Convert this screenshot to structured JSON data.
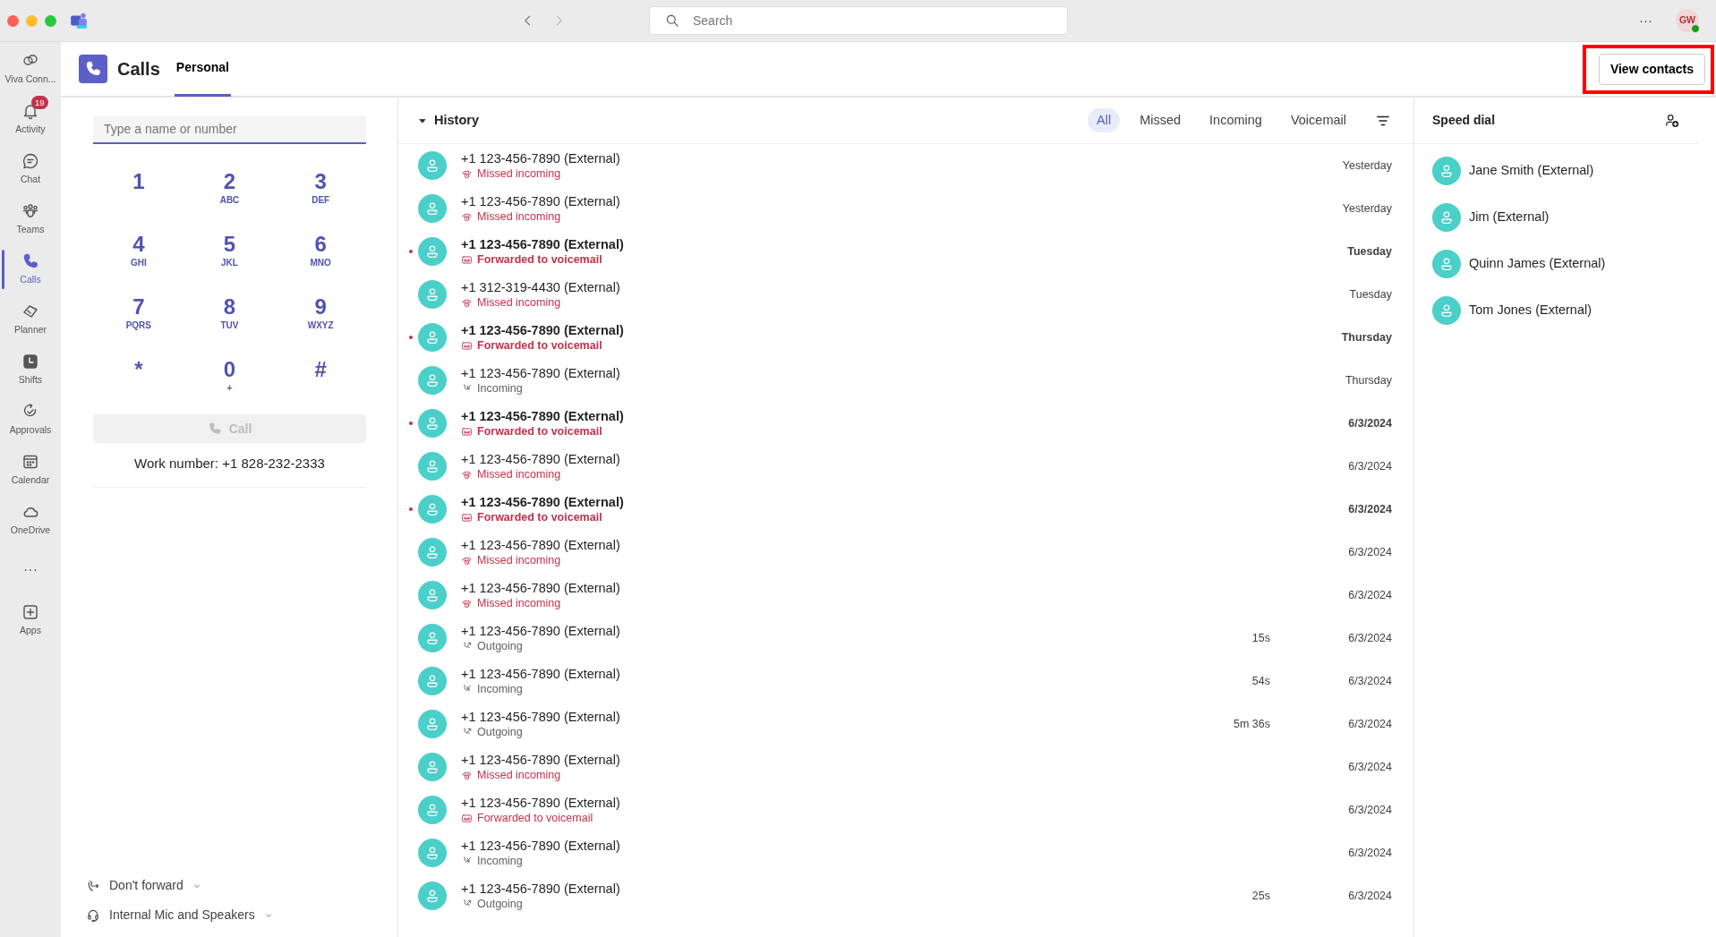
{
  "titlebar": {
    "search_placeholder": "Search",
    "more": "···",
    "avatar_initials": "GW",
    "online": true
  },
  "rail": [
    {
      "label": "Viva Conn...",
      "selected": false
    },
    {
      "label": "Activity",
      "selected": false,
      "badge": "19"
    },
    {
      "label": "Chat",
      "selected": false
    },
    {
      "label": "Teams",
      "selected": false
    },
    {
      "label": "Calls",
      "selected": true
    },
    {
      "label": "Planner",
      "selected": false
    },
    {
      "label": "Shifts",
      "selected": false
    },
    {
      "label": "Approvals",
      "selected": false
    },
    {
      "label": "Calendar",
      "selected": false
    },
    {
      "label": "OneDrive",
      "selected": false
    },
    {
      "label": "···",
      "selected": false
    },
    {
      "label": "Apps",
      "selected": false
    }
  ],
  "header": {
    "title": "Calls",
    "tabs": [
      {
        "label": "Personal",
        "selected": true
      }
    ],
    "view_contacts": {
      "label": "View contacts",
      "highlighted": true
    }
  },
  "dialpad": {
    "placeholder": "Type a name or number",
    "keys": [
      {
        "digit": "1"
      },
      {
        "digit": "2",
        "letters": "ABC"
      },
      {
        "digit": "3",
        "letters": "DEF"
      },
      {
        "digit": "4",
        "letters": "GHI"
      },
      {
        "digit": "5",
        "letters": "JKL"
      },
      {
        "digit": "6",
        "letters": "MNO"
      },
      {
        "digit": "7",
        "letters": "PQRS"
      },
      {
        "digit": "8",
        "letters": "TUV"
      },
      {
        "digit": "9",
        "letters": "WXYZ"
      },
      {
        "digit": "*"
      },
      {
        "digit": "0",
        "letters": "+"
      },
      {
        "digit": "#"
      }
    ],
    "call_button": {
      "label": "Call",
      "disabled": true
    },
    "work_number": "Work number: +1 828-232-2333",
    "settings": [
      {
        "label": "Don't forward"
      },
      {
        "label": "Internal Mic and Speakers"
      }
    ]
  },
  "history": {
    "title": "History",
    "expanded": true,
    "filters": [
      {
        "label": "All",
        "selected": true
      },
      {
        "label": "Missed",
        "selected": false
      },
      {
        "label": "Incoming",
        "selected": false
      },
      {
        "label": "Voicemail",
        "selected": false
      }
    ],
    "rows": [
      {
        "number": "+1 123-456-7890 (External)",
        "kind": "missed",
        "status": "Missed incoming",
        "unread": false,
        "date": "Yesterday"
      },
      {
        "number": "+1 123-456-7890 (External)",
        "kind": "missed",
        "status": "Missed incoming",
        "unread": false,
        "date": "Yesterday"
      },
      {
        "number": "+1 123-456-7890 (External)",
        "kind": "voicemail",
        "status": "Forwarded to voicemail",
        "unread": true,
        "date": "Tuesday"
      },
      {
        "number": "+1 312-319-4430 (External)",
        "kind": "missed",
        "status": "Missed incoming",
        "unread": false,
        "date": "Tuesday"
      },
      {
        "number": "+1 123-456-7890 (External)",
        "kind": "voicemail",
        "status": "Forwarded to voicemail",
        "unread": true,
        "date": "Thursday"
      },
      {
        "number": "+1 123-456-7890 (External)",
        "kind": "incoming",
        "status": "Incoming",
        "unread": false,
        "date": "Thursday"
      },
      {
        "number": "+1 123-456-7890 (External)",
        "kind": "voicemail",
        "status": "Forwarded to voicemail",
        "unread": true,
        "date": "6/3/2024"
      },
      {
        "number": "+1 123-456-7890 (External)",
        "kind": "missed",
        "status": "Missed incoming",
        "unread": false,
        "date": "6/3/2024"
      },
      {
        "number": "+1 123-456-7890 (External)",
        "kind": "voicemail",
        "status": "Forwarded to voicemail",
        "unread": true,
        "date": "6/3/2024"
      },
      {
        "number": "+1 123-456-7890 (External)",
        "kind": "missed",
        "status": "Missed incoming",
        "unread": false,
        "date": "6/3/2024"
      },
      {
        "number": "+1 123-456-7890 (External)",
        "kind": "missed",
        "status": "Missed incoming",
        "unread": false,
        "date": "6/3/2024"
      },
      {
        "number": "+1 123-456-7890 (External)",
        "kind": "outgoing",
        "status": "Outgoing",
        "unread": false,
        "duration": "15s",
        "date": "6/3/2024"
      },
      {
        "number": "+1 123-456-7890 (External)",
        "kind": "incoming",
        "status": "Incoming",
        "unread": false,
        "duration": "54s",
        "date": "6/3/2024"
      },
      {
        "number": "+1 123-456-7890 (External)",
        "kind": "outgoing",
        "status": "Outgoing",
        "unread": false,
        "duration": "5m 36s",
        "date": "6/3/2024"
      },
      {
        "number": "+1 123-456-7890 (External)",
        "kind": "missed",
        "status": "Missed incoming",
        "unread": false,
        "date": "6/3/2024"
      },
      {
        "number": "+1 123-456-7890 (External)",
        "kind": "voicemail",
        "status": "Forwarded to voicemail",
        "unread": false,
        "date": "6/3/2024"
      },
      {
        "number": "+1 123-456-7890 (External)",
        "kind": "incoming",
        "status": "Incoming",
        "unread": false,
        "date": "6/3/2024"
      },
      {
        "number": "+1 123-456-7890 (External)",
        "kind": "outgoing",
        "status": "Outgoing",
        "unread": false,
        "duration": "25s",
        "date": "6/3/2024"
      }
    ]
  },
  "speed_dial": {
    "title": "Speed dial",
    "contacts": [
      {
        "name": "Jane Smith (External)"
      },
      {
        "name": "Jim (External)"
      },
      {
        "name": "Quinn James (External)"
      },
      {
        "name": "Tom Jones (External)"
      }
    ]
  }
}
